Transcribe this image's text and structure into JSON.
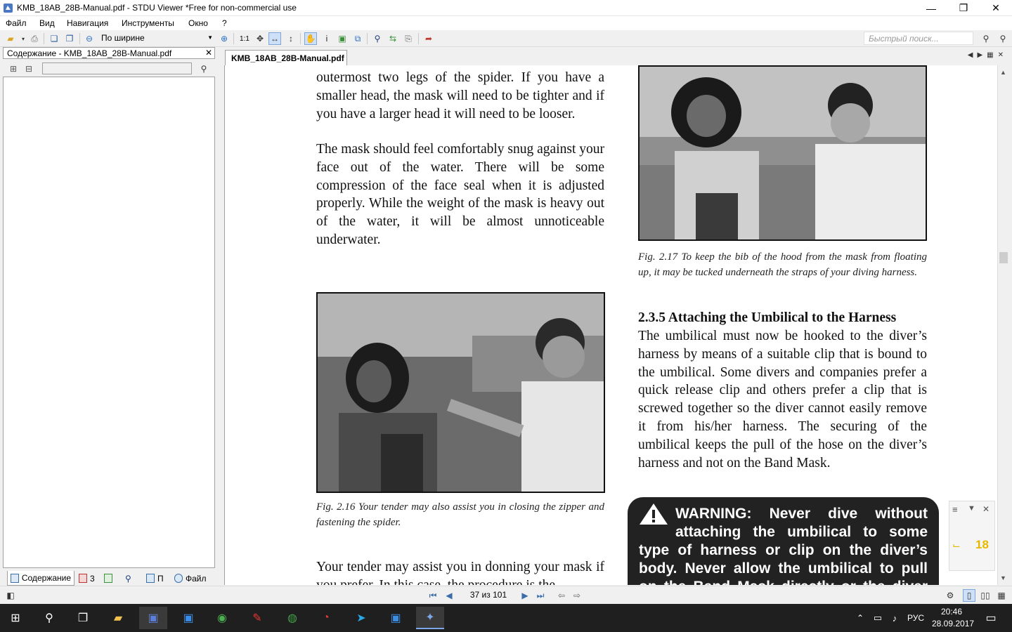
{
  "window": {
    "title": "KMB_18AB_28B-Manual.pdf - STDU Viewer *Free for non-commercial use",
    "minimize": "—",
    "maximize": "❐",
    "close": "✕"
  },
  "menu": {
    "items": [
      "Файл",
      "Вид",
      "Навигация",
      "Инструменты",
      "Окно",
      "?"
    ]
  },
  "toolbar": {
    "zoom_label": "По ширине",
    "actual_size_label": "1:1",
    "quick_search_placeholder": "Быстрый поиск..."
  },
  "sidebar": {
    "header": "Содержание - KMB_18AB_28B-Manual.pdf",
    "tabs": [
      {
        "label": "Содержание",
        "icon": "contents-icon"
      },
      {
        "label": "3",
        "icon": "bookmarks-icon"
      },
      {
        "label": "",
        "icon": "thumbnails-icon"
      },
      {
        "label": "",
        "icon": "search-icon"
      },
      {
        "label": "П",
        "icon": "pages-icon"
      },
      {
        "label": "Файл",
        "icon": "file-icon"
      }
    ]
  },
  "document": {
    "tab_label": "KMB_18AB_28B-Manual.pdf",
    "left_col": {
      "p1": "outermost two legs of the spider. If you have a smaller head, the mask will need to be tighter and if you have a larger head it will need to be looser.",
      "p2": "The mask should feel comfortably snug against your face out of the water. There will be some compression of the face seal when it is adjusted properly. While the weight of the mask is heavy out of the water, it will be almost unnoticeable underwater.",
      "fig_caption": "Fig. 2.16 Your tender may also assist you in closing the zipper and fastening the spider.",
      "p3": "Your tender may assist you in donning your mask if you prefer. In this case, the procedure is the"
    },
    "right_col": {
      "fig_caption": "Fig. 2.17 To keep the bib of the hood from the mask from floating up, it may be tucked underneath  the straps of your diving harness.",
      "heading": "2.3.5 Attaching the Umbilical to the Harness",
      "p1": "The umbilical must now be hooked to the diver’s harness by means of a suitable clip that is bound to the umbilical. Some divers and companies prefer a quick release clip and others prefer a clip that is screwed together so the diver cannot easily remove it from his/her harness. The securing of the umbilical keeps the pull of the hose on the diver’s harness and not on the Band Mask.",
      "warning": "WARNING: Never dive without attaching the umbilical to some type of harness or clip on the diver’s body. Never allow the umbilical to pull on the Band Mask directly or the diver could suffer"
    },
    "float_panel_number": "18"
  },
  "status": {
    "page_counter": "37 из 101"
  },
  "taskbar": {
    "language": "РУС",
    "time": "20:46",
    "date": "28.09.2017"
  }
}
